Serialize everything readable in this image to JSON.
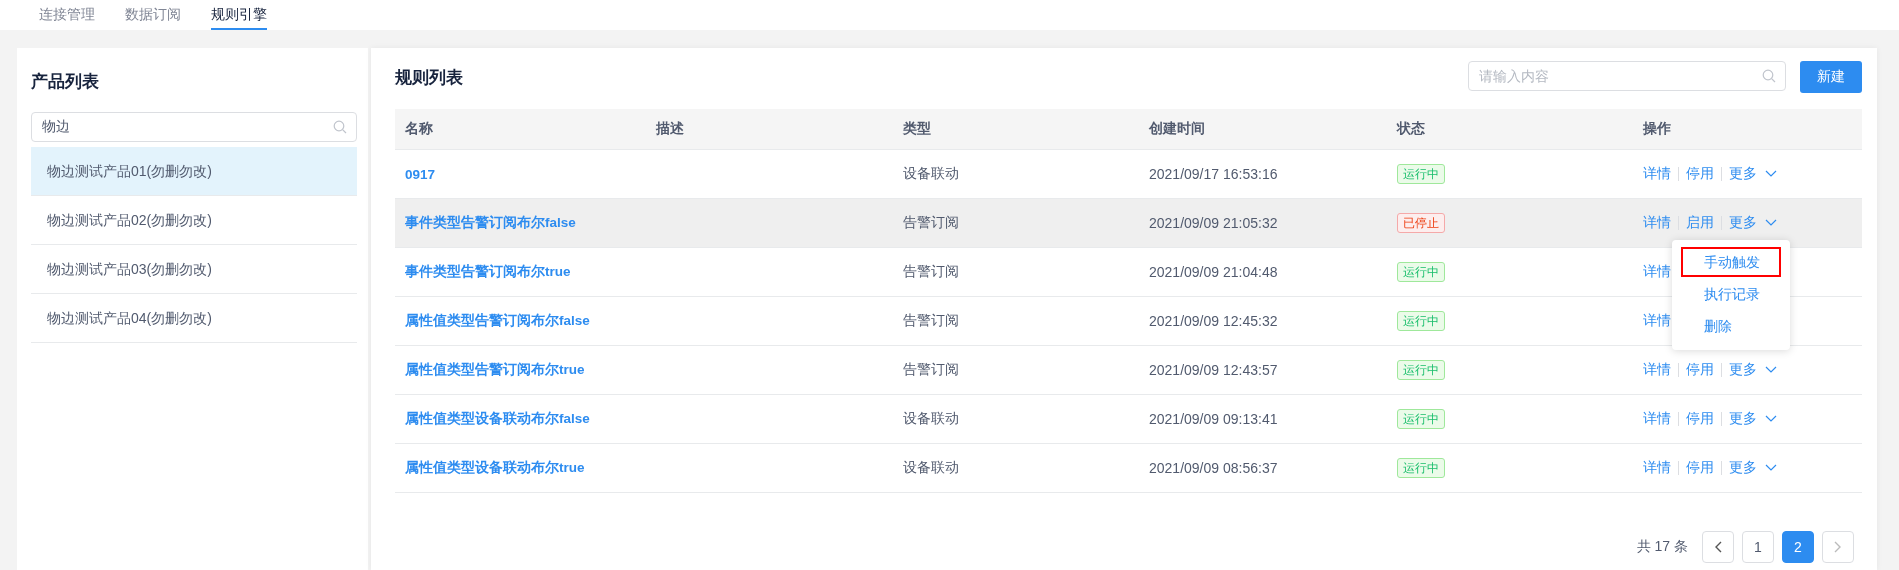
{
  "tabs": [
    {
      "label": "连接管理",
      "selected": false
    },
    {
      "label": "数据订阅",
      "selected": false
    },
    {
      "label": "规则引擎",
      "selected": true
    }
  ],
  "product_panel": {
    "title": "产品列表",
    "search": {
      "value": "物边"
    },
    "items": [
      {
        "label": "物边测试产品01(勿删勿改)",
        "selected": true
      },
      {
        "label": "物边测试产品02(勿删勿改)",
        "selected": false
      },
      {
        "label": "物边测试产品03(勿删勿改)",
        "selected": false
      },
      {
        "label": "物边测试产品04(勿删勿改)",
        "selected": false
      }
    ]
  },
  "rule_panel": {
    "title": "规则列表",
    "search": {
      "placeholder": "请输入内容"
    },
    "new_button": "新建",
    "table": {
      "columns": [
        "名称",
        "描述",
        "类型",
        "创建时间",
        "状态",
        "操作"
      ],
      "rows": [
        {
          "name": "0917",
          "type": "设备联动",
          "created": "2021/09/17 16:53:16",
          "status": {
            "label": "运行中",
            "kind": "running"
          },
          "actions": [
            "详情",
            "停用"
          ],
          "more": "更多",
          "highlighted": false
        },
        {
          "name": "事件类型告警订阅布尔false",
          "type": "告警订阅",
          "created": "2021/09/09 21:05:32",
          "status": {
            "label": "已停止",
            "kind": "stopped"
          },
          "actions": [
            "详情",
            "启用"
          ],
          "more": "更多",
          "highlighted": true
        },
        {
          "name": "事件类型告警订阅布尔true",
          "type": "告警订阅",
          "created": "2021/09/09 21:04:48",
          "status": {
            "label": "运行中",
            "kind": "running"
          },
          "actions": [
            "详情"
          ],
          "highlighted": false
        },
        {
          "name": "属性值类型告警订阅布尔false",
          "type": "告警订阅",
          "created": "2021/09/09 12:45:32",
          "status": {
            "label": "运行中",
            "kind": "running"
          },
          "actions": [
            "详情"
          ],
          "highlighted": false
        },
        {
          "name": "属性值类型告警订阅布尔true",
          "type": "告警订阅",
          "created": "2021/09/09 12:43:57",
          "status": {
            "label": "运行中",
            "kind": "running"
          },
          "actions": [
            "详情",
            "停用"
          ],
          "more": "更多",
          "highlighted": false
        },
        {
          "name": "属性值类型设备联动布尔false",
          "type": "设备联动",
          "created": "2021/09/09 09:13:41",
          "status": {
            "label": "运行中",
            "kind": "running"
          },
          "actions": [
            "详情",
            "停用"
          ],
          "more": "更多",
          "highlighted": false
        },
        {
          "name": "属性值类型设备联动布尔true",
          "type": "设备联动",
          "created": "2021/09/09 08:56:37",
          "status": {
            "label": "运行中",
            "kind": "running"
          },
          "actions": [
            "详情",
            "停用"
          ],
          "more": "更多",
          "highlighted": false
        }
      ]
    },
    "dropdown": {
      "items": [
        {
          "label": "手动触发",
          "focused": true
        },
        {
          "label": "执行记录",
          "focused": false
        },
        {
          "label": "删除",
          "focused": false
        }
      ]
    },
    "pagination": {
      "total": "共 17 条",
      "pages": [
        {
          "label": "1",
          "selected": false
        },
        {
          "label": "2",
          "selected": true
        }
      ]
    }
  }
}
